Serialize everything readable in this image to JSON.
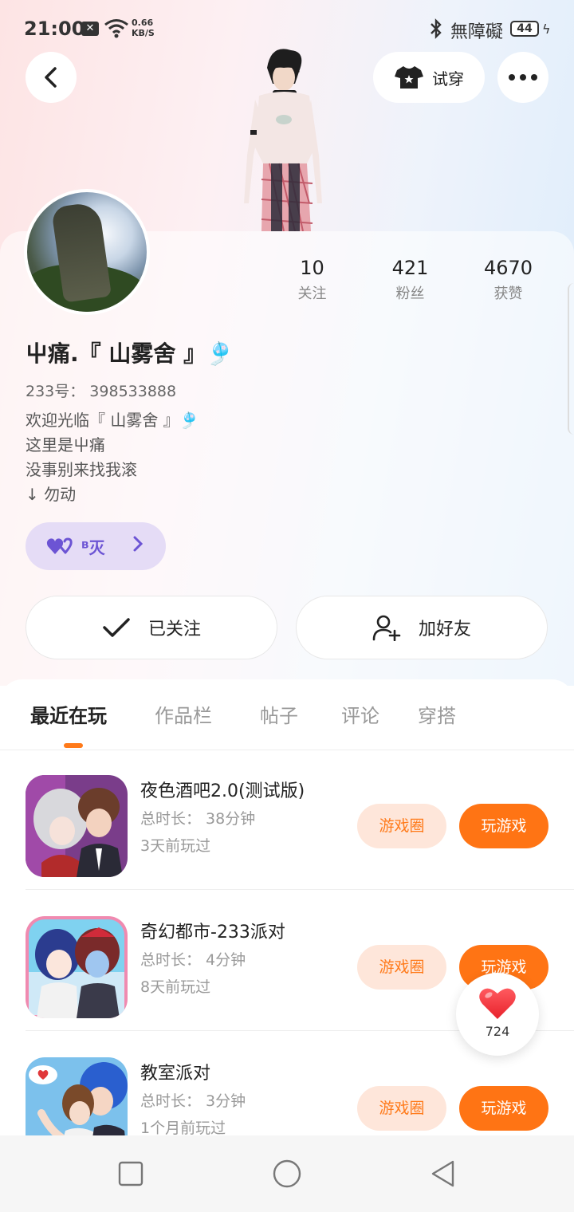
{
  "status_bar": {
    "time": "21:00",
    "speed_value": "0.66",
    "speed_unit": "KB/S",
    "accessibility": "無障礙",
    "battery": "44"
  },
  "header": {
    "try_on_label": "试穿"
  },
  "profile": {
    "stats": [
      {
        "num": "10",
        "label": "关注"
      },
      {
        "num": "421",
        "label": "粉丝"
      },
      {
        "num": "4670",
        "label": "获赞"
      }
    ],
    "name": "屮痛.『 山雾舍 』🎐",
    "uid": "233号： 398533888",
    "bio": [
      "欢迎光临『 山雾舍 』🎐",
      "这里是屮痛",
      "没事别来找我滚",
      "↓ 勿动"
    ],
    "badge_label": "ᴮ灭",
    "follow_label": "已关注",
    "friend_label": "加好友"
  },
  "tabs": [
    "最近在玩",
    "作品栏",
    "帖子",
    "评论",
    "穿搭"
  ],
  "games": [
    {
      "title": "夜色酒吧2.0(测试版)",
      "duration": "总时长： 38分钟",
      "played": "3天前玩过",
      "circle_label": "游戏圈",
      "play_label": "玩游戏"
    },
    {
      "title": "奇幻都市-233派对",
      "duration": "总时长： 4分钟",
      "played": "8天前玩过",
      "circle_label": "游戏圈",
      "play_label": "玩游戏"
    },
    {
      "title": "教室派对",
      "duration": "总时长： 3分钟",
      "played": "1个月前玩过",
      "circle_label": "游戏圈",
      "play_label": "玩游戏"
    }
  ],
  "like_count": "724",
  "colors": {
    "accent": "#ff7414",
    "badge": "#6c54d4"
  }
}
